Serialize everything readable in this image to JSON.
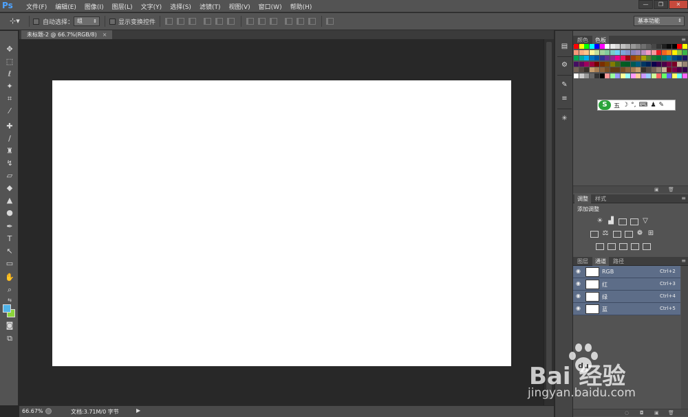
{
  "app": {
    "logo": "Ps",
    "menu": [
      "文件(F)",
      "编辑(E)",
      "图像(I)",
      "图层(L)",
      "文字(Y)",
      "选择(S)",
      "滤镜(T)",
      "视图(V)",
      "窗口(W)",
      "帮助(H)"
    ],
    "window_controls": [
      "—",
      "❐",
      "✕"
    ]
  },
  "options_bar": {
    "auto_select_label": "自动选择：",
    "auto_select_value": "组",
    "show_transform_label": "显示变换控件",
    "workspace": "基本功能"
  },
  "document": {
    "tab_title": "未标题-2 @ 66.7%(RGB/8)",
    "tab_close": "×",
    "canvas_color": "#ffffff"
  },
  "status_bar": {
    "zoom": "66.67%",
    "doc_info": "文档:3.71M/0 字节",
    "arrow": "▶"
  },
  "tool_colors": {
    "foreground": "#4fb3e8",
    "background": "#8bd33b"
  },
  "swatch_panel": {
    "tabs": [
      "颜色",
      "色板"
    ],
    "active_tab": "色板",
    "menu_icon": "≡"
  },
  "ime_bar": {
    "logo": "S",
    "items": [
      "五",
      "☽",
      "°,",
      "⌨",
      "♟",
      "✎"
    ]
  },
  "adjustments_panel": {
    "tabs": [
      "调整",
      "样式"
    ],
    "active_tab": "调整",
    "title": "添加调整",
    "icons": [
      "brightness-icon",
      "levels-icon",
      "curves-icon",
      "exposure-icon",
      "vibrance-icon",
      "hue-saturation-icon",
      "color-balance-icon",
      "black-white-icon",
      "photo-filter-icon",
      "channel-mixer-icon",
      "color-lookup-icon",
      "invert-icon",
      "posterize-icon",
      "threshold-icon",
      "selective-color-icon",
      "gradient-map-icon"
    ]
  },
  "channels_panel": {
    "tabs": [
      "图层",
      "通道",
      "路径"
    ],
    "active_tab": "通道",
    "channels": [
      {
        "name": "RGB",
        "shortcut": "Ctrl+2"
      },
      {
        "name": "红",
        "shortcut": "Ctrl+3"
      },
      {
        "name": "绿",
        "shortcut": "Ctrl+4"
      },
      {
        "name": "蓝",
        "shortcut": "Ctrl+5"
      }
    ]
  },
  "watermark": {
    "brand": "Bai 经验",
    "url": "jingyan.baidu.com"
  }
}
